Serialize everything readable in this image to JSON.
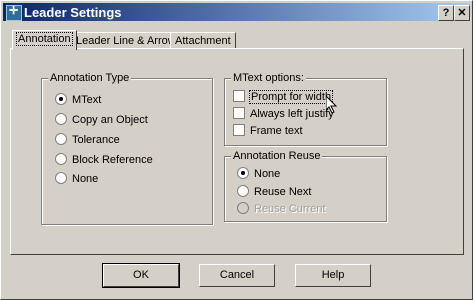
{
  "window": {
    "title": "Leader Settings",
    "help_glyph": "?",
    "close_glyph": "✕",
    "icon": "autocad-app-icon"
  },
  "tabs": [
    {
      "label": "Annotation",
      "selected": true
    },
    {
      "label": "Leader Line & Arrow",
      "selected": false
    },
    {
      "label": "Attachment",
      "selected": false
    }
  ],
  "annotation_type": {
    "legend": "Annotation Type",
    "options": [
      {
        "label": "MText",
        "checked": true
      },
      {
        "label": "Copy an Object",
        "checked": false
      },
      {
        "label": "Tolerance",
        "checked": false
      },
      {
        "label": "Block Reference",
        "checked": false
      },
      {
        "label": "None",
        "checked": false
      }
    ]
  },
  "mtext_options": {
    "legend": "MText options:",
    "options": [
      {
        "label": "Prompt for width",
        "checked": false
      },
      {
        "label": "Always left justify",
        "checked": false
      },
      {
        "label": "Frame text",
        "checked": false
      }
    ]
  },
  "annotation_reuse": {
    "legend": "Annotation Reuse",
    "options": [
      {
        "label": "None",
        "checked": true,
        "enabled": true
      },
      {
        "label": "Reuse Next",
        "checked": false,
        "enabled": true
      },
      {
        "label": "Reuse Current",
        "checked": false,
        "enabled": false
      }
    ]
  },
  "buttons": {
    "ok": "OK",
    "cancel": "Cancel",
    "help": "Help"
  },
  "colors": {
    "title_start": "#0a246a",
    "title_end": "#a6caf0",
    "face": "#d4d0c8"
  }
}
